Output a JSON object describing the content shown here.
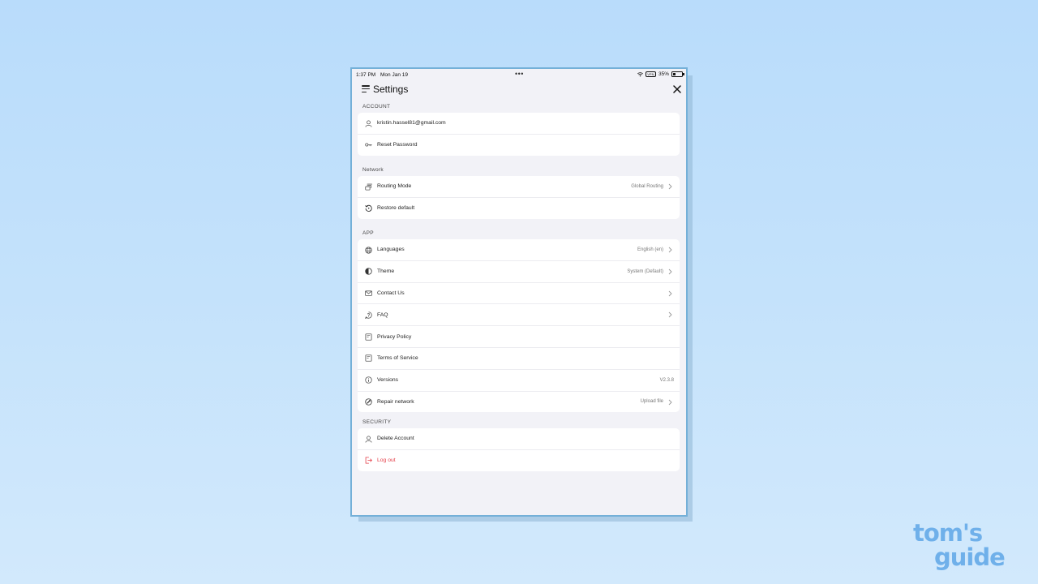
{
  "status_bar": {
    "time": "1:37 PM",
    "date": "Mon Jan 19",
    "vpn_badge": "VPN",
    "battery": "35%",
    "battery_level": 0.35
  },
  "header": {
    "title": "Settings"
  },
  "sections": {
    "account": {
      "label": "ACCOUNT",
      "items": [
        {
          "label": "kristin.hassel81@gmail.com",
          "icon": "user-icon"
        },
        {
          "label": "Reset Password",
          "icon": "key-icon"
        }
      ]
    },
    "network": {
      "label": "Network",
      "items": [
        {
          "label": "Routing Mode",
          "value": "Global Routing",
          "icon": "routing-icon"
        },
        {
          "label": "Restore default",
          "icon": "restore-icon"
        }
      ]
    },
    "app": {
      "label": "APP",
      "items": [
        {
          "label": "Languages",
          "value": "English (en)",
          "icon": "globe-icon"
        },
        {
          "label": "Theme",
          "value": "System (Default)",
          "icon": "theme-icon"
        },
        {
          "label": "Contact Us",
          "icon": "mail-icon"
        },
        {
          "label": "FAQ",
          "icon": "faq-icon"
        },
        {
          "label": "Privacy Policy",
          "icon": "document-icon"
        },
        {
          "label": "Terms of Service",
          "icon": "document-icon"
        },
        {
          "label": "Versions",
          "value": "V2.3.8",
          "icon": "info-icon"
        },
        {
          "label": "Repair network",
          "value": "Upload file",
          "icon": "repair-icon"
        }
      ]
    },
    "security": {
      "label": "SECURITY",
      "items": [
        {
          "label": "Delete Account",
          "icon": "user-icon"
        },
        {
          "label": "Log out",
          "icon": "logout-icon",
          "color": "#e5414b"
        }
      ]
    }
  },
  "watermark": {
    "line1": "tom's",
    "line2": "guide",
    "color": "#6fb0ea"
  }
}
